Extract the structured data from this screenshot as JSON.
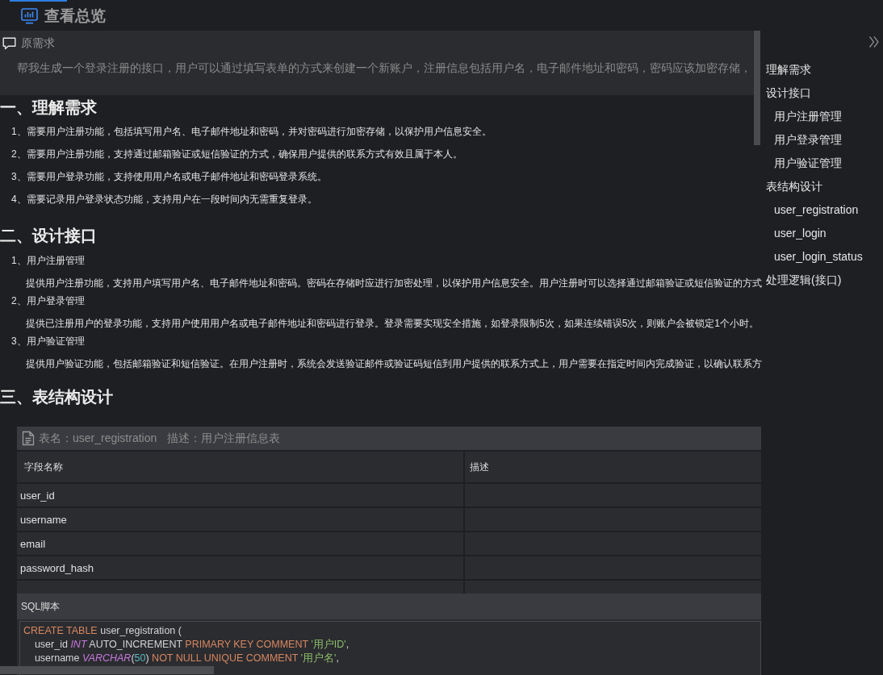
{
  "header": {
    "title": "查看总览"
  },
  "requirement": {
    "label": "原需求",
    "text": "帮我生成一个登录注册的接口，用户可以通过填写表单的方式来创建一个新账户，注册信息包括用户名，电子邮件地址和密码，密码应该加密存储，"
  },
  "sections": [
    {
      "kind": "list",
      "heading": "一、理解需求",
      "items": [
        "1、需要用户注册功能，包括填写用户名、电子邮件地址和密码，并对密码进行加密存储，以保护用户信息安全。",
        "2、需要用户注册功能，支持通过邮箱验证或短信验证的方式，确保用户提供的联系方式有效且属于本人。",
        "3、需要用户登录功能，支持使用用户名或电子邮件地址和密码登录系统。",
        "4、需要记录用户登录状态功能，支持用户在一段时间内无需重复登录。"
      ]
    },
    {
      "kind": "subsections",
      "heading": "二、设计接口",
      "items": [
        {
          "title": "1、用户注册管理",
          "description": "提供用户注册功能，支持用户填写用户名、电子邮件地址和密码。密码在存储时应进行加密处理，以保护用户信息安全。用户注册时可以选择通过邮箱验证或短信验证的方式"
        },
        {
          "title": "2、用户登录管理",
          "description": "提供已注册用户的登录功能，支持用户使用用户名或电子邮件地址和密码进行登录。登录需要实现安全措施，如登录限制5次，如果连续错误5次，则账户会被锁定1个小时。"
        },
        {
          "title": "3、用户验证管理",
          "description": "提供用户验证功能，包括邮箱验证和短信验证。在用户注册时，系统会发送验证邮件或验证码短信到用户提供的联系方式上，用户需要在指定时间内完成验证，以确认联系方"
        }
      ]
    },
    {
      "kind": "tables",
      "heading": "三、表结构设计",
      "table": {
        "name_label": "表名：user_registration",
        "description_label": "描述：用户注册信息表",
        "columns": [
          "字段名称",
          "描述"
        ],
        "rows": [
          {
            "field": "user_id"
          },
          {
            "field": "username"
          },
          {
            "field": "email"
          },
          {
            "field": "password_hash"
          }
        ],
        "sql_label": "SQL脚本",
        "sql_lines": [
          {
            "tokens": [
              {
                "kind": "keyword",
                "text": "CREATE TABLE"
              },
              {
                "kind": "plain",
                "text": " user_registration ("
              }
            ]
          },
          {
            "tokens": [
              {
                "kind": "plain",
                "text": "    user_id "
              },
              {
                "kind": "type",
                "text": "INT"
              },
              {
                "kind": "plain",
                "text": " AUTO_INCREMENT "
              },
              {
                "kind": "keyword",
                "text": "PRIMARY KEY COMMENT "
              },
              {
                "kind": "string",
                "text": "'用户ID'"
              },
              {
                "kind": "plain",
                "text": ","
              }
            ]
          },
          {
            "tokens": [
              {
                "kind": "plain",
                "text": "    username "
              },
              {
                "kind": "type",
                "text": "VARCHAR"
              },
              {
                "kind": "plain",
                "text": "("
              },
              {
                "kind": "number",
                "text": "50"
              },
              {
                "kind": "plain",
                "text": ") "
              },
              {
                "kind": "keyword",
                "text": "NOT NULL UNIQUE COMMENT "
              },
              {
                "kind": "string",
                "text": "'用户名'"
              },
              {
                "kind": "plain",
                "text": ","
              }
            ]
          }
        ]
      }
    }
  ],
  "outline": [
    {
      "label": "理解需求"
    },
    {
      "label": "设计接口",
      "children": [
        {
          "label": "用户注册管理"
        },
        {
          "label": "用户登录管理"
        },
        {
          "label": "用户验证管理"
        }
      ]
    },
    {
      "label": "表结构设计",
      "children": [
        {
          "label": "user_registration"
        },
        {
          "label": "user_login"
        },
        {
          "label": "user_login_status"
        }
      ]
    },
    {
      "label": "处理逻辑(接口)"
    }
  ]
}
